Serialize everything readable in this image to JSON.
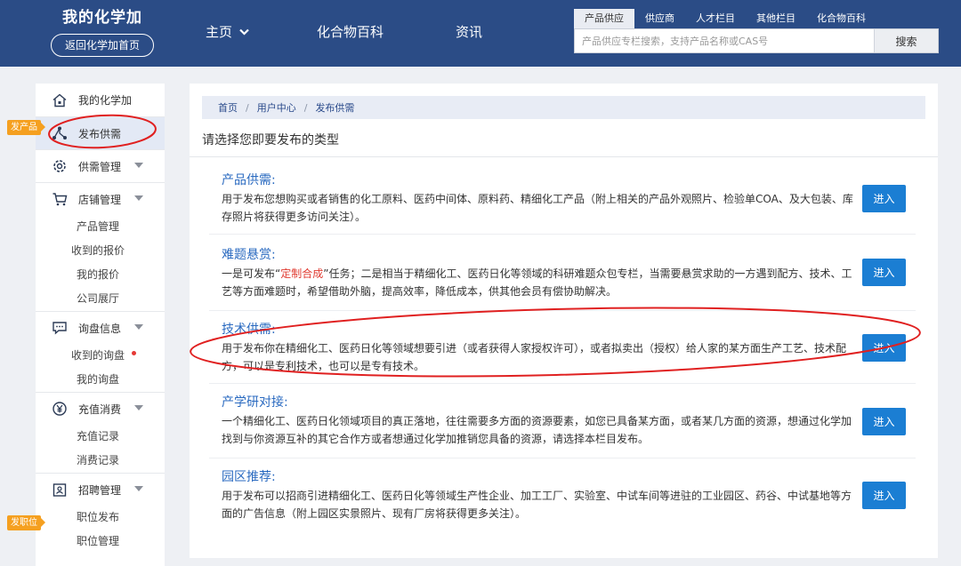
{
  "header": {
    "brand_title": "我的化学加",
    "back_button": "返回化学加首页",
    "nav": [
      {
        "label": "主页"
      },
      {
        "label": "化合物百科"
      },
      {
        "label": "资讯"
      }
    ],
    "search_tabs": [
      "产品供应",
      "供应商",
      "人才栏目",
      "其他栏目",
      "化合物百科"
    ],
    "search_placeholder": "产品供应专栏搜索，支持产品名称或CAS号",
    "search_button": "搜索"
  },
  "sidebar": {
    "groups": [
      {
        "label": "我的化学加",
        "icon": "home-icon",
        "subs": []
      },
      {
        "label": "发布供需",
        "icon": "share-nodes-icon",
        "active": true,
        "subs": []
      },
      {
        "label": "供需管理",
        "icon": "gear-icon",
        "subs": []
      },
      {
        "label": "店铺管理",
        "icon": "cart-icon",
        "subs": [
          "产品管理",
          "收到的报价",
          "我的报价",
          "公司展厅"
        ]
      },
      {
        "label": "询盘信息",
        "icon": "message-icon",
        "subs": [
          "收到的询盘",
          "我的询盘"
        ]
      },
      {
        "label": "充值消费",
        "icon": "yen-coin-icon",
        "subs": [
          "充值记录",
          "消费记录"
        ]
      },
      {
        "label": "招聘管理",
        "icon": "job-icon",
        "subs": [
          "职位发布",
          "职位管理"
        ]
      }
    ],
    "tags": {
      "product": "发产品",
      "job": "发职位"
    }
  },
  "main": {
    "breadcrumb": [
      "首页",
      "用户中心",
      "发布供需"
    ],
    "title": "请选择您即要发布的类型",
    "items": [
      {
        "title": "产品供需:",
        "desc": "用于发布您想购买或者销售的化工原料、医药中间体、原料药、精细化工产品（附上相关的产品外观照片、检验单COA、及大包装、库存照片将获得更多访问关注）。",
        "button": "进入"
      },
      {
        "title": "难题悬赏:",
        "desc_before": "一是可发布“",
        "desc_highlight": "定制合成",
        "desc_after": "”任务；二是相当于精细化工、医药日化等领域的科研难题众包专栏，当需要悬赏求助的一方遇到配方、技术、工艺等方面难题时，希望借助外脑，提高效率，降低成本，供其他会员有偿协助解决。",
        "button": "进入"
      },
      {
        "title": "技术供需:",
        "desc": "用于发布你在精细化工、医药日化等领域想要引进（或者获得人家授权许可），或者拟卖出（授权）给人家的某方面生产工艺、技术配方，可以是专利技术，也可以是专有技术。",
        "button": "进入"
      },
      {
        "title": "产学研对接:",
        "desc": "一个精细化工、医药日化领域项目的真正落地，往往需要多方面的资源要素，如您已具备某方面，或者某几方面的资源，想通过化学加找到与你资源互补的其它合作方或者想通过化学加推销您具备的资源，请选择本栏目发布。",
        "button": "进入"
      },
      {
        "title": "园区推荐:",
        "desc": "用于发布可以招商引进精细化工、医药日化等领域生产性企业、加工工厂、实验室、中试车间等进驻的工业园区、药谷、中试基地等方面的广告信息（附上园区实景照片、现有厂房将获得更多关注）。",
        "button": "进入"
      }
    ]
  },
  "colors": {
    "header_bg": "#2b4c86",
    "link_blue": "#2a6ac0",
    "button_blue": "#1b7ed3",
    "highlight_red": "#e03a30",
    "tag_orange": "#f5a020",
    "annotation_red": "#e02020"
  }
}
